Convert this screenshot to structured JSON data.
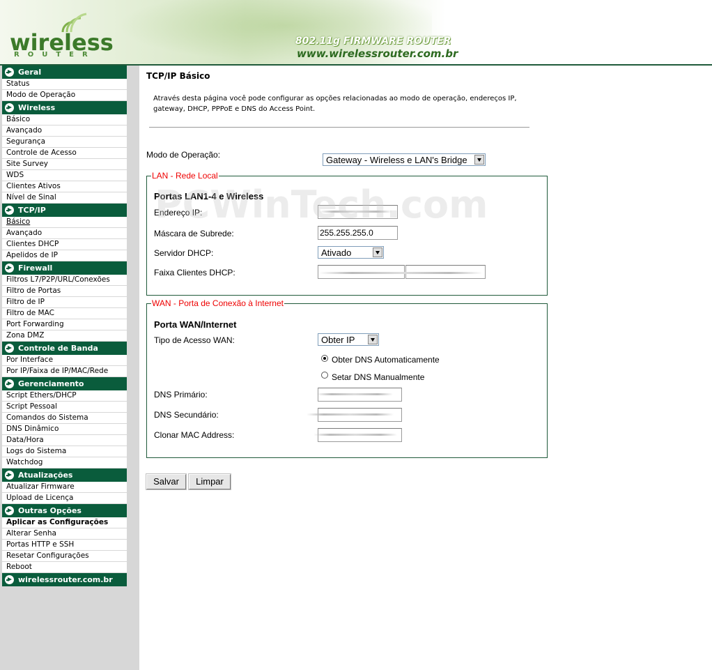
{
  "header": {
    "logo_text": "wireless",
    "logo_sub": "ROUTER",
    "firmware_title": "802.11g FIRMWARE ROUTER",
    "firmware_url": "www.wirelessrouter.com.br"
  },
  "sidebar": {
    "sections": [
      {
        "title": "Geral",
        "items": [
          "Status",
          "Modo de Operação"
        ]
      },
      {
        "title": "Wireless",
        "items": [
          "Básico",
          "Avançado",
          "Segurança",
          "Controle de Acesso",
          "Site Survey",
          "WDS",
          "Clientes Ativos",
          "Nível de Sinal"
        ]
      },
      {
        "title": "TCP/IP",
        "items": [
          "Básico",
          "Avançado",
          "Clientes DHCP",
          "Apelidos de IP"
        ]
      },
      {
        "title": "Firewall",
        "items": [
          "Filtros L7/P2P/URL/Conexões",
          "Filtro de Portas",
          "Filtro de IP",
          "Filtro de MAC",
          "Port Forwarding",
          "Zona DMZ"
        ]
      },
      {
        "title": "Controle de Banda",
        "items": [
          "Por Interface",
          "Por IP/Faixa de IP/MAC/Rede"
        ]
      },
      {
        "title": "Gerenciamento",
        "items": [
          "Script Ethers/DHCP",
          "Script Pessoal",
          "Comandos do Sistema",
          "DNS Dinâmico",
          "Data/Hora",
          "Logs do Sistema",
          "Watchdog"
        ]
      },
      {
        "title": "Atualizações",
        "items": [
          "Atualizar Firmware",
          "Upload de Licença"
        ]
      },
      {
        "title": "Outras Opções",
        "items": [
          "Aplicar as Configurações",
          "Alterar Senha",
          "Portas HTTP e SSH",
          "Resetar Configurações",
          "Reboot"
        ]
      },
      {
        "title": "wirelessrouter.com.br",
        "items": []
      }
    ],
    "active_item": "TCP/IP > Básico"
  },
  "main": {
    "title": "TCP/IP Básico",
    "description": "Através desta página você pode configurar as opções relacionadas ao modo de operação, endereços IP, gateway, DHCP, PPPoE e DNS do Access Point.",
    "modo_label": "Modo de Operação:",
    "modo_value": "Gateway - Wireless e LAN's Bridge",
    "lan": {
      "legend": "LAN - Rede Local",
      "heading": "Portas LAN1-4 e Wireless",
      "ip_label": "Endereço IP:",
      "ip_value": "",
      "mask_label": "Máscara de Subrede:",
      "mask_value": "255.255.255.0",
      "dhcp_label": "Servidor DHCP:",
      "dhcp_value": "Ativado",
      "range_label": "Faixa Clientes DHCP:",
      "range_value": ""
    },
    "wan": {
      "legend": "WAN - Porta de Conexão à Internet",
      "heading": "Porta WAN/Internet",
      "tipo_label": "Tipo de Acesso WAN:",
      "tipo_value": "Obter IP",
      "dns_auto": "Obter DNS Automaticamente",
      "dns_manual": "Setar DNS Manualmente",
      "dns1_label": "DNS Primário:",
      "dns2_label": "DNS Secundário:",
      "mac_label": "Clonar MAC Address:"
    },
    "save_label": "Salvar",
    "clear_label": "Limpar"
  },
  "watermark": "PCWinTech.com",
  "colors": {
    "menu_header": "#0a5c3c",
    "legend": "#ee0000",
    "logo_green": "#3c7a2a"
  }
}
